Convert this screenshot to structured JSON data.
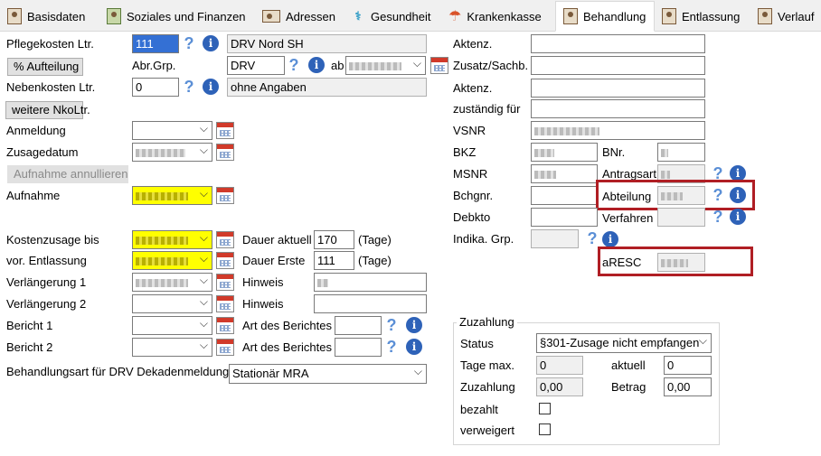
{
  "tabs": [
    {
      "label": "Basisdaten",
      "icon": "person-card-icon"
    },
    {
      "label": "Soziales und Finanzen",
      "icon": "money-stack-icon"
    },
    {
      "label": "Adressen",
      "icon": "address-card-icon"
    },
    {
      "label": "Gesundheit",
      "icon": "caduceus-icon"
    },
    {
      "label": "Krankenkasse",
      "icon": "umbrella-icon"
    },
    {
      "label": "Behandlung",
      "icon": "person-card-icon",
      "active": true
    },
    {
      "label": "Entlassung",
      "icon": "person-card-icon"
    },
    {
      "label": "Verlauf",
      "icon": "person-card-icon"
    }
  ],
  "left": {
    "pflegekosten_label": "Pflegekosten Ltr.",
    "pflegekosten_value": "111",
    "kostentraeger": "DRV Nord SH",
    "aufteilung_button": "% Aufteilung",
    "abrgrp_label": "Abr.Grp.",
    "abrgrp_value": "DRV",
    "ab_label": "ab",
    "nebenkosten_label": "Nebenkosten Ltr.",
    "nebenkosten_value": "0",
    "nebenkosten_text": "ohne Angaben",
    "weitere_button": "weitere NkoLtr.",
    "anmeldung_label": "Anmeldung",
    "zusagedatum_label": "Zusagedatum",
    "annullieren_button": "Aufnahme annullieren",
    "aufnahme_label": "Aufnahme",
    "kostenzusage_label": "Kostenzusage bis",
    "dauer_aktuell_label": "Dauer aktuell",
    "dauer_aktuell_value": "170",
    "tage_label": "(Tage)",
    "vor_entlassung_label": "vor. Entlassung",
    "dauer_erste_label": "Dauer Erste",
    "dauer_erste_value": "111",
    "verlaengerung1_label": "Verlängerung 1",
    "hinweis_label": "Hinweis",
    "verlaengerung2_label": "Verlängerung 2",
    "bericht1_label": "Bericht 1",
    "art_berichtes_label": "Art des Berichtes",
    "bericht2_label": "Bericht 2",
    "behandlungsart_label": "Behandlungsart für DRV Dekadenmeldung",
    "behandlungsart_value": "Stationär MRA"
  },
  "right": {
    "aktenz_label": "Aktenz.",
    "zusatz_label": "Zusatz/Sachb.",
    "zustaendig_label": "zuständig für",
    "vsnr_label": "VSNR",
    "bkz_label": "BKZ",
    "bnr_label": "BNr.",
    "msnr_label": "MSNR",
    "antragsart_label": "Antragsart",
    "bchgnr_label": "Bchgnr.",
    "abteilung_label": "Abteilung",
    "debkto_label": "Debkto",
    "verfahren_label": "Verfahren",
    "indika_label": "Indika. Grp.",
    "aresc_label": "aRESC"
  },
  "zuzahlung": {
    "title": "Zuzahlung",
    "status_label": "Status",
    "status_value": "§301-Zusage nicht empfangen",
    "tage_max_label": "Tage max.",
    "tage_max_value": "0",
    "aktuell_label": "aktuell",
    "aktuell_value": "0",
    "zuzahlung_label": "Zuzahlung",
    "zuzahlung_value": "0,00",
    "betrag_label": "Betrag",
    "betrag_value": "0,00",
    "bezahlt_label": "bezahlt",
    "verweigert_label": "verweigert"
  },
  "colors": {
    "highlight_yellow": "#ffff00",
    "annotation_red": "#b01e24",
    "selection_blue": "#3470d4"
  }
}
